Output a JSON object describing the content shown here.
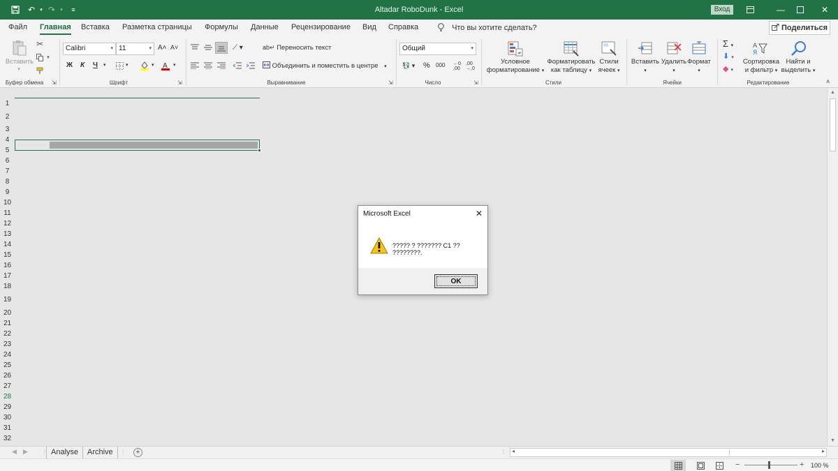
{
  "titlebar": {
    "doc_title": "Altadar RoboDunk",
    "separator": "-",
    "app_name": "Excel",
    "login_label": "Вход"
  },
  "tabs": [
    {
      "label": "Файл"
    },
    {
      "label": "Главная",
      "active": true
    },
    {
      "label": "Вставка"
    },
    {
      "label": "Разметка страницы"
    },
    {
      "label": "Формулы"
    },
    {
      "label": "Данные"
    },
    {
      "label": "Рецензирование"
    },
    {
      "label": "Вид"
    },
    {
      "label": "Справка"
    }
  ],
  "tellme": "Что вы хотите сделать?",
  "share_label": "Поделиться",
  "ribbon": {
    "clipboard": {
      "paste_label": "Вставить",
      "group_label": "Буфер обмена"
    },
    "font": {
      "font_name": "Calibri",
      "font_size": "11",
      "bold": "Ж",
      "italic": "К",
      "underline": "Ч",
      "group_label": "Шрифт"
    },
    "alignment": {
      "wrap_text": "Переносить текст",
      "merge_center": "Объединить и поместить в центре",
      "group_label": "Выравнивание"
    },
    "number": {
      "format": "Общий",
      "group_label": "Число"
    },
    "styles": {
      "conditional_line1": "Условное",
      "conditional_line2": "форматирование",
      "format_table_line1": "Форматировать",
      "format_table_line2": "как таблицу",
      "cell_styles_line1": "Стили",
      "cell_styles_line2": "ячеек",
      "group_label": "Стили"
    },
    "cells": {
      "insert": "Вставить",
      "delete": "Удалить",
      "format": "Формат",
      "group_label": "Ячейки"
    },
    "editing": {
      "sort_line1": "Сортировка",
      "sort_line2": "и фильтр",
      "find_line1": "Найти и",
      "find_line2": "выделить",
      "group_label": "Редактирование"
    }
  },
  "rows": [
    "1",
    "2",
    "3",
    "4",
    "5",
    "6",
    "7",
    "8",
    "9",
    "10",
    "11",
    "12",
    "13",
    "14",
    "15",
    "16",
    "17",
    "18",
    "19",
    "20",
    "21",
    "22",
    "23",
    "24",
    "25",
    "26",
    "27",
    "28",
    "29",
    "30",
    "31",
    "32"
  ],
  "highlighted_row": "28",
  "sheet_tabs": [
    "Analyse",
    "Archive"
  ],
  "status": {
    "zoom": "100 %"
  },
  "dialog": {
    "title": "Microsoft Excel",
    "message": "????? ? ??????? C1 ?? ????????.",
    "ok_label": "OK"
  }
}
